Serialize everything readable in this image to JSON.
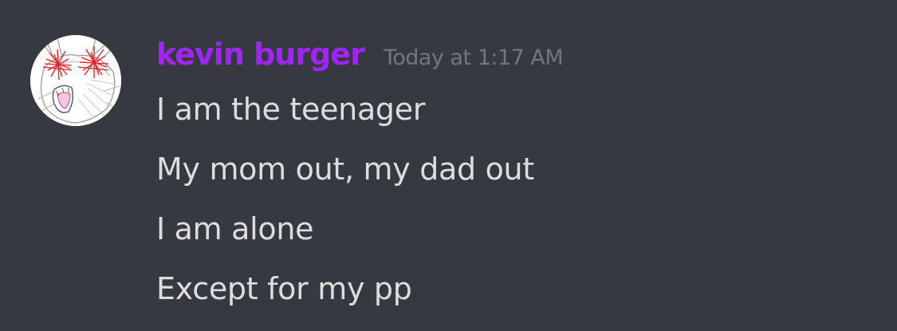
{
  "message": {
    "author": {
      "name": "kevin burger",
      "name_color": "#a125f2",
      "avatar_icon": "sketched-face-avatar"
    },
    "timestamp": "Today at 1:17 AM",
    "lines": [
      "I am the teenager",
      "My mom out, my dad out",
      "I am alone",
      "Except for my pp"
    ]
  },
  "colors": {
    "background": "#36393f",
    "timestamp": "#72767d",
    "text": "#dcddde"
  }
}
